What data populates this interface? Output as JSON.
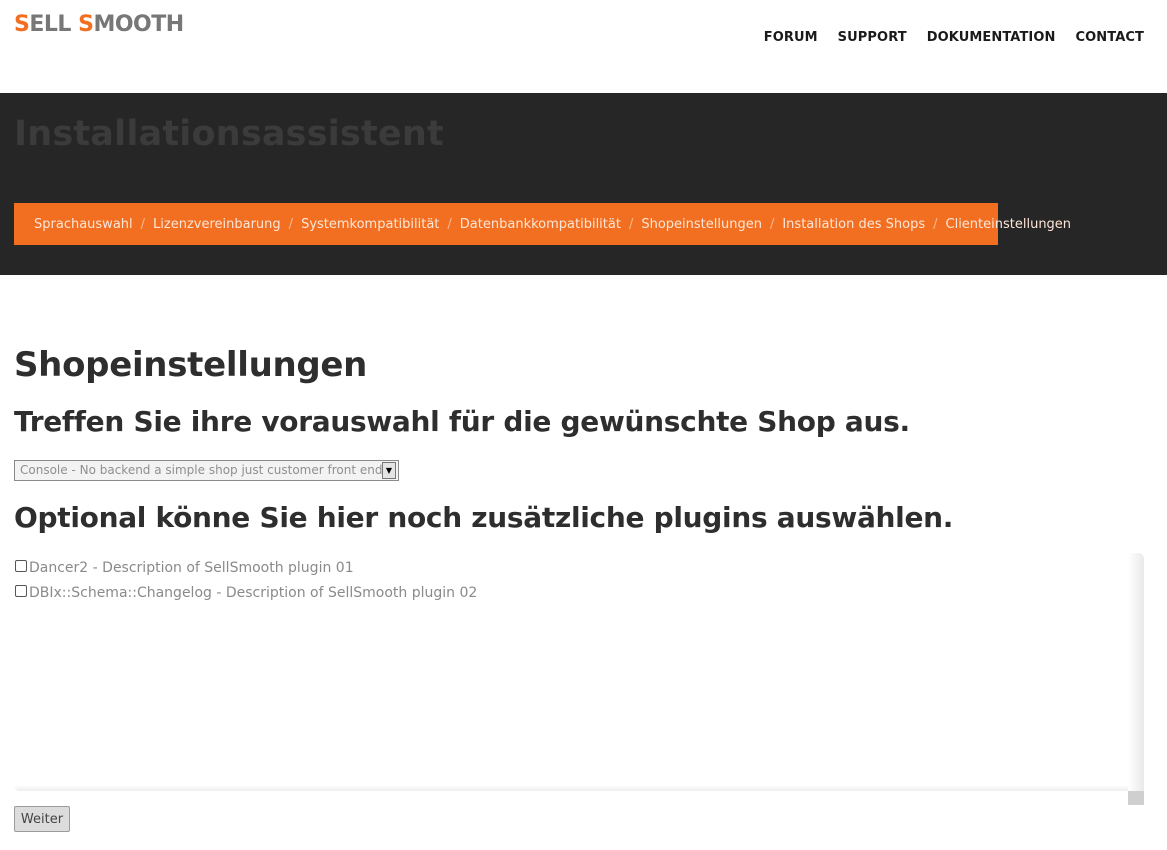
{
  "logo": {
    "first_letter": "S",
    "first_rest": "ELL ",
    "second_letter": "S",
    "second_rest": "MOOTH"
  },
  "nav": [
    "FORUM",
    "SUPPORT",
    "DOKUMENTATION",
    "CONTACT"
  ],
  "banner": {
    "title": "Installationsassistent",
    "breadcrumb": [
      "Sprachauswahl",
      "Lizenzvereinbarung",
      "Systemkompatibilität",
      "Datenbankkompatibilität",
      "Shopeinstellungen",
      "Installation des Shops",
      "Clienteinstellungen"
    ],
    "separator": "/"
  },
  "main": {
    "title": "Shopeinstellungen",
    "subtitle": "Treffen Sie ihre vorauswahl für die gewünschte Shop aus.",
    "shop_select": {
      "selected": "Console - No backend a simple shop just customer front end"
    },
    "optional_title": "Optional könne Sie hier noch zusätzliche plugins auswählen.",
    "plugins": [
      {
        "label": "Dancer2 - Description of SellSmooth plugin 01",
        "checked": false
      },
      {
        "label": "DBIx::Schema::Changelog - Description of SellSmooth plugin 02",
        "checked": false
      }
    ],
    "next_button": "Weiter"
  },
  "colors": {
    "accent": "#f26f21",
    "banner_bg": "#262626"
  }
}
